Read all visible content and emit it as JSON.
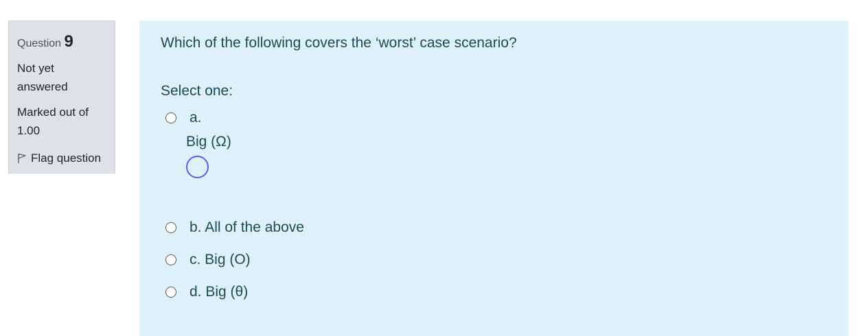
{
  "info": {
    "question_word": "Question",
    "question_number": "9",
    "state_line1": "Not yet",
    "state_line2": "answered",
    "grade_line1": "Marked out of",
    "grade_line2": "1.00",
    "flag_label": "Flag question",
    "flag_icon": "flag-icon"
  },
  "question": {
    "text": "Which of the following covers the ‘worst’ case scenario?",
    "prompt": "Select one:",
    "options": [
      {
        "label": "a.",
        "text": "Big (Ω)"
      },
      {
        "label": "b. All of the above"
      },
      {
        "label": "c. Big (O)"
      },
      {
        "label": "d. Big (θ)"
      }
    ]
  },
  "colors": {
    "info_bg": "#dee2e6",
    "content_bg": "#def1f8",
    "text": "#1d4a59",
    "focus_ring": "#5b5be8"
  }
}
